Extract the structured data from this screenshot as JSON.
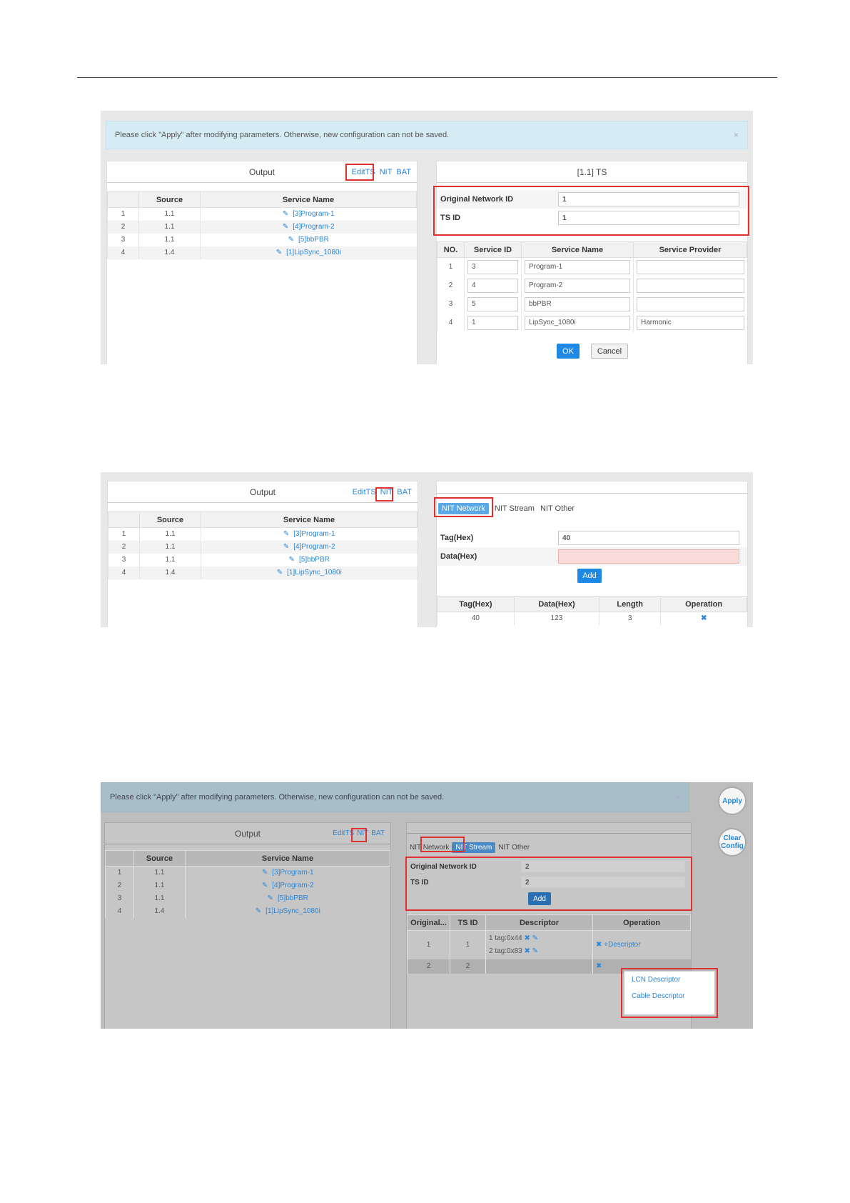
{
  "output_panel": {
    "title": "Output",
    "links": [
      "EditTS",
      "NIT",
      "BAT"
    ],
    "headers": [
      "Source",
      "Service Name"
    ],
    "rows": [
      {
        "no": "1",
        "source": "1.1",
        "service": "[3]Program-1"
      },
      {
        "no": "2",
        "source": "1.1",
        "service": "[4]Program-2"
      },
      {
        "no": "3",
        "source": "1.1",
        "service": "[5]bbPBR"
      },
      {
        "no": "4",
        "source": "1.4",
        "service": "[1]LipSync_1080i"
      }
    ]
  },
  "shot1": {
    "alert": "Please click \"Apply\" after modifying parameters. Otherwise, new configuration can not be saved.",
    "close": "×",
    "right_title": "[1.1] TS",
    "orig_net_label": "Original Network ID",
    "orig_net_value": "1",
    "tsid_label": "TS ID",
    "tsid_value": "1",
    "headers": [
      "NO.",
      "Service ID",
      "Service Name",
      "Service Provider"
    ],
    "rows": [
      {
        "no": "1",
        "sid": "3",
        "name": "Program-1",
        "provider": ""
      },
      {
        "no": "2",
        "sid": "4",
        "name": "Program-2",
        "provider": ""
      },
      {
        "no": "3",
        "sid": "5",
        "name": "bbPBR",
        "provider": ""
      },
      {
        "no": "4",
        "sid": "1",
        "name": "LipSync_1080i",
        "provider": "Harmonic"
      }
    ],
    "ok": "OK",
    "cancel": "Cancel"
  },
  "shot2": {
    "tabs": [
      "NIT Network",
      "NIT Stream",
      "NIT Other"
    ],
    "tag_label": "Tag(Hex)",
    "tag_value": "40",
    "data_label": "Data(Hex)",
    "data_value": "",
    "add": "Add",
    "headers": [
      "Tag(Hex)",
      "Data(Hex)",
      "Length",
      "Operation"
    ],
    "row": {
      "tag": "40",
      "data": "123",
      "length": "3",
      "op": "✖"
    }
  },
  "shot3": {
    "alert": "Please click \"Apply\" after modifying parameters. Otherwise, new configuration can not be saved.",
    "apply": "Apply",
    "clear": "Clear Config",
    "tabs": [
      "NIT Network",
      "NIT Stream",
      "NIT Other"
    ],
    "orig_net_label": "Original Network ID",
    "orig_net_value": "2",
    "tsid_label": "TS ID",
    "tsid_value": "2",
    "add": "Add",
    "headers": [
      "Original...",
      "TS ID",
      "Descriptor",
      "Operation"
    ],
    "rows": [
      {
        "orig": "1",
        "tsid": "1",
        "desc": [
          "1 tag:0x44",
          "2 tag:0x83"
        ],
        "op": "+Descriptor"
      },
      {
        "orig": "2",
        "tsid": "2",
        "desc": [],
        "op": ""
      }
    ],
    "dropdown": [
      "LCN Descriptor",
      "Cable Descriptor"
    ]
  },
  "colors": {
    "accent": "#1e88e5",
    "highlight": "#e03131",
    "alert_bg": "#d6ecf5"
  }
}
